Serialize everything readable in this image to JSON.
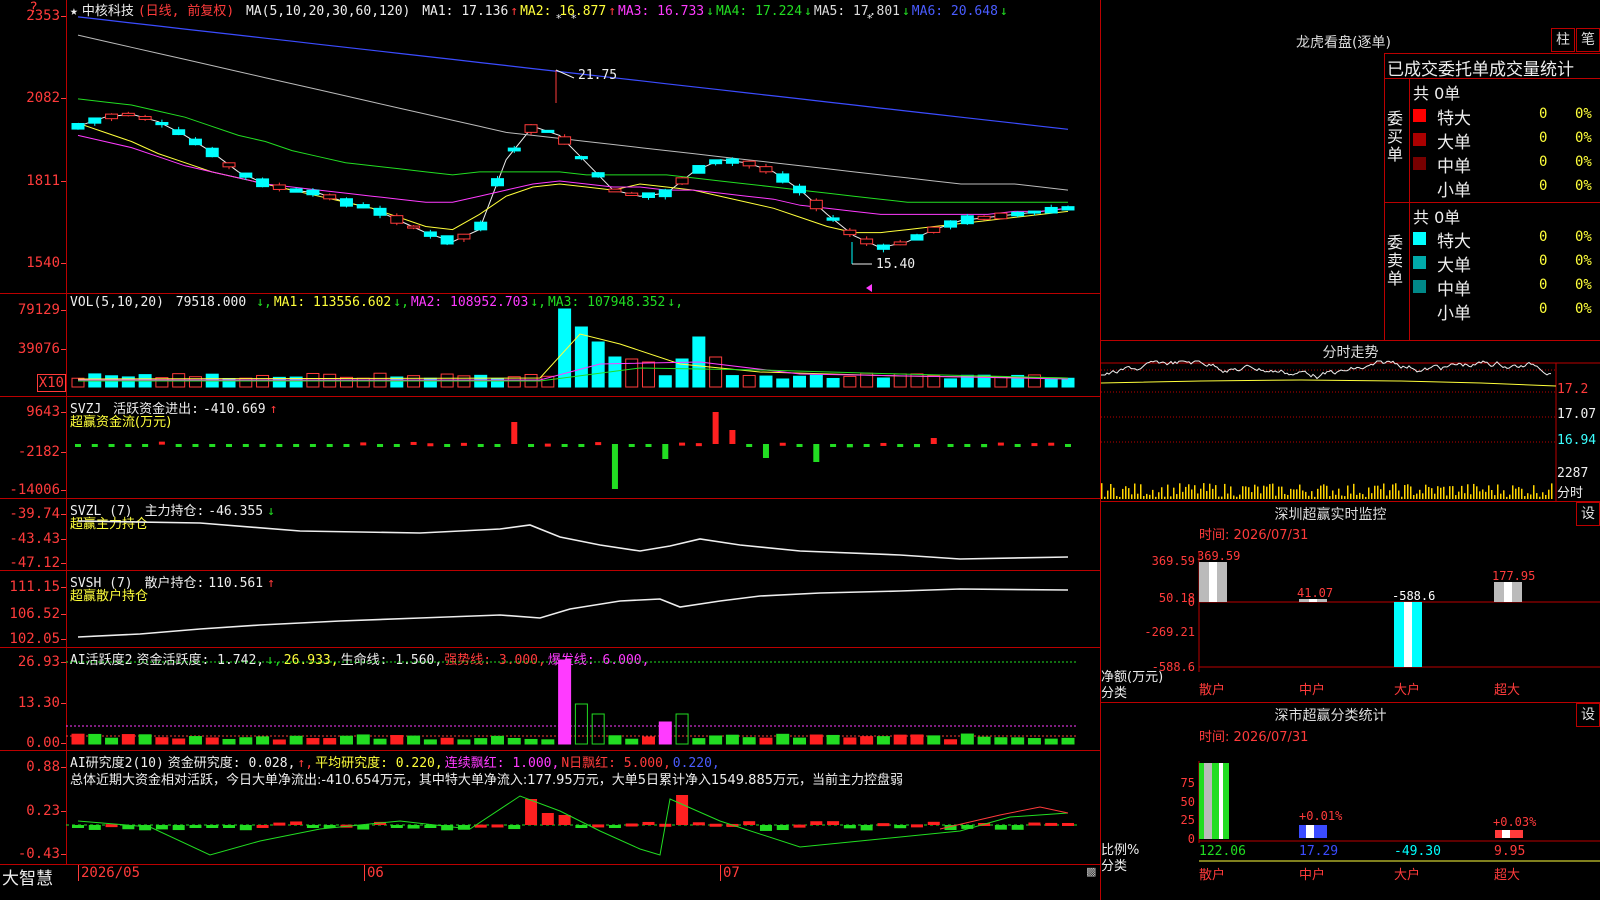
{
  "stock": {
    "name": "中核科技",
    "mode": "(日线, 前复权)",
    "star": "★",
    "marker": "?",
    "ma_params": "MA(5,10,20,30,60,120)",
    "ma": [
      {
        "label": "MA1:",
        "value": "17.136",
        "arrow": "↑",
        "color": "#eeeeee"
      },
      {
        "label": "MA2:",
        "value": "16.877",
        "arrow": "↑",
        "color": "#ffff3b"
      },
      {
        "label": "MA3:",
        "value": "16.733",
        "arrow": "↓",
        "color": "#ff3bff"
      },
      {
        "label": "MA4:",
        "value": "17.224",
        "arrow": "↓",
        "color": "#22dd22"
      },
      {
        "label": "MA5:",
        "value": "17.801",
        "arrow": "↓",
        "color": "#dddddd"
      },
      {
        "label": "MA6:",
        "value": "20.648",
        "arrow": "↓",
        "color": "#4a5cff"
      }
    ],
    "high_label": "21.75",
    "low_label": "15.40"
  },
  "price_axis": [
    "2353",
    "2082",
    "1811",
    "1540"
  ],
  "vol": {
    "title": "VOL(5,10,20)",
    "value": "79518.000",
    "items": [
      {
        "label": "MA1:",
        "value": "113556.602",
        "arrow": "↓",
        "color": "#ffff3b"
      },
      {
        "label": "MA2:",
        "value": "108952.703",
        "arrow": "↓",
        "color": "#ff3bff"
      },
      {
        "label": "MA3:",
        "value": "107948.352",
        "arrow": "↓",
        "color": "#22dd22"
      }
    ],
    "axis": [
      "79129",
      "39076"
    ],
    "unit": "X10"
  },
  "svzj": {
    "title": "SVZJ",
    "label": "活跃资金进出:",
    "value": "-410.669",
    "arrow": "↑",
    "sub": "超赢资金流(万元)",
    "axis": [
      "9643",
      "-2182",
      "-14006"
    ]
  },
  "svzl": {
    "title": "SVZL (7)",
    "label": "主力持仓:",
    "value": "-46.355",
    "arrow": "↓",
    "sub": "超赢主力持仓",
    "axis": [
      "-39.74",
      "-43.43",
      "-47.12"
    ]
  },
  "svsh": {
    "title": "SVSH (7)",
    "label": "散户持仓:",
    "value": "110.561",
    "arrow": "↑",
    "sub": "超赢散户持仓",
    "axis": [
      "111.15",
      "106.52",
      "102.05"
    ]
  },
  "ai_active": {
    "title": "AI活跃度2",
    "items": [
      {
        "text": "资金活跃度: 1.742",
        "color": "#eeeeee"
      },
      {
        "text": "↓",
        "color": "#22dd22"
      },
      {
        "text": "26.933",
        "color": "#ffff3b"
      },
      {
        "text": "生命线: 1.560",
        "color": "#eeeeee"
      },
      {
        "text": "强势线: 3.000",
        "color": "#ff3b3b"
      },
      {
        "text": "爆发线: 6.000",
        "color": "#ff3bff"
      }
    ],
    "axis": [
      "26.93",
      "13.30",
      "0.00"
    ]
  },
  "ai_research": {
    "title": "AI研究度2(10)",
    "items": [
      {
        "text": "资金研究度: 0.028",
        "color": "#eeeeee"
      },
      {
        "text": "↑",
        "color": "#ff3b3b"
      },
      {
        "text": "平均研究度: 0.220",
        "color": "#ffff3b"
      },
      {
        "text": "连续飘红: 1.000",
        "color": "#ff3bff"
      },
      {
        "text": "N日飘红: 5.000",
        "color": "#ff3b3b"
      },
      {
        "text": "0.220",
        "color": "#4a5cff"
      }
    ],
    "summary": "总体近期大资金相对活跃，今日大单净流出:-410.654万元，其中特大单净流入:177.95万元，大单5日累计净入1549.885万元，当前主力控盘弱",
    "axis": [
      "0.88",
      "0.23",
      "-0.43"
    ]
  },
  "bottom": {
    "brand": "大智慧",
    "dates": [
      "2026/05",
      "06",
      "07"
    ]
  },
  "dragon_tiger": {
    "title": "龙虎看盘(逐单)",
    "btn1": "柱",
    "btn2": "笔",
    "header": "已成交委托单成交量统计",
    "buy_side": "委买单",
    "sell_side": "委卖单",
    "buy_total": "共 0单",
    "sell_total": "共 0单",
    "buy_rows": [
      {
        "name": "特大",
        "count": "0",
        "pct": "0%",
        "color": "#ff0000"
      },
      {
        "name": "大单",
        "count": "0",
        "pct": "0%",
        "color": "#aa0000"
      },
      {
        "name": "中单",
        "count": "0",
        "pct": "0%",
        "color": "#770000"
      },
      {
        "name": "小单",
        "count": "0",
        "pct": "0%",
        "color": ""
      }
    ],
    "sell_rows": [
      {
        "name": "特大",
        "count": "0",
        "pct": "0%",
        "color": "#00ffff"
      },
      {
        "name": "大单",
        "count": "0",
        "pct": "0%",
        "color": "#00aaaa"
      },
      {
        "name": "中单",
        "count": "0",
        "pct": "0%",
        "color": "#008888"
      },
      {
        "name": "小单",
        "count": "0",
        "pct": "0%",
        "color": ""
      }
    ]
  },
  "intraday": {
    "title": "分时走势",
    "prices": [
      "17.2",
      "17.07",
      "16.94"
    ],
    "vol_label": "2287",
    "unit": "分时"
  },
  "sz_monitor": {
    "title": "深圳超赢实时监控",
    "btn": "设",
    "time": "时间: 2026/07/31",
    "axis": [
      "369.59",
      "50.18",
      "0",
      "-269.21",
      "-588.6"
    ],
    "ylabel": "净额(万元)",
    "xlabel": "分类",
    "categories": [
      "散户",
      "中户",
      "大户",
      "超大"
    ],
    "values": [
      "369.59",
      "41.07",
      "-588.6",
      "177.95"
    ]
  },
  "sz_class": {
    "title": "深市超赢分类统计",
    "btn": "设",
    "time": "时间: 2026/07/31",
    "axis": [
      "75",
      "50",
      "25",
      "0"
    ],
    "ylabel": "比例%",
    "xlabel": "分类",
    "categories": [
      "散户",
      "中户",
      "大户",
      "超大"
    ],
    "values": [
      "122.06",
      "17.29",
      "-49.30",
      "9.95"
    ],
    "pct_labels": [
      "",
      "+0.01%",
      "",
      "+0.03%"
    ]
  },
  "chart_data": {
    "type": "line",
    "title": "中核科技 (日线, 前复权)",
    "ylim": [
      1540,
      2353
    ],
    "series": [
      {
        "name": "MA1",
        "values": [
          1990,
          2020,
          2030,
          2005,
          1960,
          1905,
          1840,
          1800,
          1780,
          1770,
          1740,
          1720,
          1680,
          1640,
          1610,
          1650,
          1880,
          1990,
          1960,
          1870,
          1780,
          1760,
          1770,
          1840,
          1880,
          1870,
          1840,
          1780,
          1700,
          1630,
          1590,
          1610,
          1650,
          1680,
          1690,
          1700,
          1710,
          1720
        ]
      },
      {
        "name": "MA2",
        "values": [
          2000,
          1970,
          1940,
          1900,
          1870,
          1840,
          1820,
          1800,
          1780,
          1760,
          1740,
          1720,
          1690,
          1660,
          1650,
          1700,
          1760,
          1790,
          1800,
          1790,
          1780,
          1800,
          1790,
          1780,
          1760,
          1740,
          1720,
          1690,
          1660,
          1640,
          1640,
          1650,
          1660,
          1670,
          1680,
          1690,
          1700,
          1710
        ]
      },
      {
        "name": "MA3",
        "values": [
          1960,
          1940,
          1920,
          1890,
          1860,
          1840,
          1820,
          1800,
          1790,
          1780,
          1770,
          1760,
          1750,
          1740,
          1740,
          1760,
          1780,
          1800,
          1810,
          1800,
          1790,
          1790,
          1780,
          1780,
          1770,
          1760,
          1750,
          1730,
          1720,
          1710,
          1700,
          1700,
          1700,
          1700,
          1700,
          1710,
          1710,
          1720
        ]
      },
      {
        "name": "MA4",
        "values": [
          2080,
          2070,
          2060,
          2040,
          2020,
          1990,
          1960,
          1940,
          1910,
          1890,
          1870,
          1860,
          1850,
          1840,
          1830,
          1840,
          1840,
          1840,
          1840,
          1830,
          1830,
          1830,
          1830,
          1820,
          1810,
          1800,
          1790,
          1780,
          1770,
          1760,
          1750,
          1740,
          1740,
          1740,
          1740,
          1740,
          1740,
          1740
        ]
      },
      {
        "name": "MA5",
        "values": [
          2290,
          2270,
          2250,
          2230,
          2210,
          2190,
          2170,
          2150,
          2130,
          2110,
          2090,
          2070,
          2050,
          2030,
          2010,
          1990,
          1970,
          1960,
          1950,
          1940,
          1930,
          1920,
          1910,
          1900,
          1890,
          1880,
          1870,
          1860,
          1850,
          1840,
          1830,
          1820,
          1810,
          1800,
          1800,
          1800,
          1790,
          1780
        ]
      },
      {
        "name": "MA6",
        "values": [
          2350,
          2340,
          2330,
          2320,
          2310,
          2300,
          2290,
          2280,
          2270,
          2260,
          2250,
          2240,
          2230,
          2220,
          2210,
          2200,
          2190,
          2180,
          2170,
          2160,
          2150,
          2140,
          2130,
          2120,
          2110,
          2100,
          2090,
          2080,
          2070,
          2060,
          2050,
          2040,
          2030,
          2020,
          2010,
          2000,
          1990,
          1980
        ]
      }
    ]
  }
}
